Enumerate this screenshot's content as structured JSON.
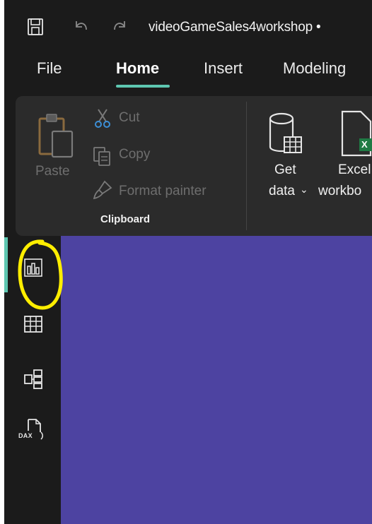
{
  "titlebar": {
    "document_title": "videoGameSales4workshop •"
  },
  "menu": {
    "tabs": [
      {
        "label": "File"
      },
      {
        "label": "Home",
        "active": true
      },
      {
        "label": "Insert"
      },
      {
        "label": "Modeling"
      }
    ]
  },
  "ribbon": {
    "clipboard": {
      "paste_label": "Paste",
      "cut_label": "Cut",
      "copy_label": "Copy",
      "format_painter_label": "Format painter",
      "group_label": "Clipboard"
    },
    "data": {
      "get_data_line1": "Get",
      "get_data_line2": "data",
      "excel_line1": "Excel",
      "excel_line2": "workbo",
      "excel_badge": "X"
    }
  },
  "leftnav": {
    "items": [
      {
        "name": "report-view",
        "icon": "bar-chart-icon",
        "active": true
      },
      {
        "name": "table-view",
        "icon": "table-grid-icon"
      },
      {
        "name": "model-view",
        "icon": "model-diagram-icon"
      },
      {
        "name": "dax-query-view",
        "icon": "dax-query-icon",
        "badge": "DAX"
      }
    ]
  },
  "colors": {
    "accent": "#5ec7b1",
    "canvas": "#4d43a1",
    "annotation": "#ffee00",
    "excel_green": "#1f7a44"
  }
}
